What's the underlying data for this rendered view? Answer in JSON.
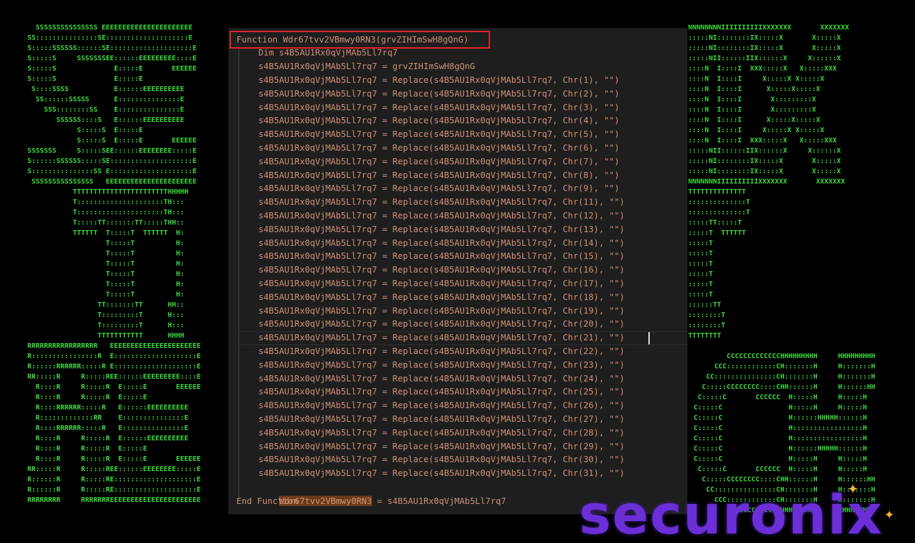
{
  "ascii_art": {
    "left": [
      "  SSSSSSSSSSSSSSS EEEEEEEEEEEEEEEEEEEEEE",
      "SS:::::::::::::::SE::::::::::::::::::::E",
      "S:::::SSSSSS::::::SE::::::::::::::::::::E",
      "S:::::S     SSSSSSSEE::::::EEEEEEEEE::::E",
      "S:::::S              E:::::E       EEEEEE",
      "S:::::S              E:::::E",
      " S::::SSSS           E::::::EEEEEEEEEE",
      "  SS::::::SSSSS      E:::::::::::::::E",
      "    SSS::::::::SS    E:::::::::::::::E",
      "       SSSSSS::::S   E::::::EEEEEEEEEE",
      "            S:::::S  E:::::E",
      "            S:::::S  E:::::E       EEEEEE",
      "SSSSSSS     S:::::SEE::::::EEEEEEEE:::::E",
      "S::::::SSSSSS:::::SE::::::::::::::::::::E",
      "S:::::::::::::::SS E::::::::::::::::::::E",
      " SSSSSSSSSSSSSSS   EEEEEEEEEEEEEEEEEEEEEE",
      "           TTTTTTTTTTTTTTTTTTTTTTTHHHHH",
      "           T:::::::::::::::::::::TH:::",
      "           T:::::::::::::::::::::TH:::",
      "           T:::::TT:::::::TT:::::THH::",
      "           TTTTTT  T:::::T  TTTTTT  H:",
      "                   T:::::T          H:",
      "                   T:::::T          H:",
      "                   T:::::T          H:",
      "                   T:::::T          H:",
      "                   T:::::T          H:",
      "                   T:::::T          H:",
      "                 TT:::::::TT      HH::",
      "                 T:::::::::T      H:::",
      "                 T:::::::::T      H:::",
      "                 TTTTTTTTTTT      HHHH",
      "RRRRRRRRRRRRRRRRR   EEEEEEEEEEEEEEEEEEEEEE",
      "R::::::::::::::::R  E::::::::::::::::::::E",
      "R::::::RRRRRR:::::R E::::::::::::::::::::E",
      "RR:::::R     R:::::REE::::::EEEEEEEEE::::E",
      "  R::::R     R:::::R  E:::::E       EEEEEE",
      "  R::::R     R:::::R  E:::::E",
      "  R::::RRRRRR:::::R   E::::::EEEEEEEEEE",
      "  R:::::::::::::RR    E:::::::::::::::E",
      "  R::::RRRRRR:::::R   E:::::::::::::::E",
      "  R::::R     R:::::R  E::::::EEEEEEEEEE",
      "  R::::R     R:::::R  E:::::E",
      "  R::::R     R:::::R  E:::::E       EEEEEE",
      "RR:::::R     R:::::REE::::::EEEEEEEE:::::E",
      "R::::::R     R:::::RE::::::::::::::::::::E",
      "R::::::R     R:::::RE::::::::::::::::::::E",
      "RRRRRRRR     RRRRRRREEEEEEEEEEEEEEEEEEEEEE"
    ],
    "right": [
      "NNNNNNNNIIIIIIIIIIXXXXXXX       XXXXXXX",
      ":::::NI::::::::IX:::::X       X:::::X",
      ":::::NI::::::::IX:::::X       X:::::X",
      ":::::NII::::::IIX::::::X     X::::::X",
      "::::N  I::::I  XXX:::::X   X:::::XXX",
      "::::N  I::::I     X:::::X X:::::X",
      "::::N  I::::I      X:::::X:::::X",
      "::::N  I::::I       X:::::::::X",
      "::::N  I::::I       X:::::::::X",
      "::::N  I::::I      X:::::X:::::X",
      "::::N  I::::I     X:::::X X:::::X",
      "::::N  I::::I  XXX:::::X   X:::::XXX",
      ":::::NII::::::IIX::::::X     X::::::X",
      ":::::NI::::::::IX:::::X       X:::::X",
      ":::::NI::::::::IX:::::X       X:::::X",
      "NNNNNNNIIIIIIIIIIXXXXXXX       XXXXXXX",
      "TTTTTTTTTTTTTT",
      "::::::::::::::T",
      "::::::::::::::T",
      ":::::TT:::::T",
      ":::::T  TTTTTT",
      ":::::T",
      ":::::T",
      ":::::T",
      ":::::T",
      ":::::T",
      ":::::T",
      "::::::TT",
      "::::::::T",
      "::::::::T",
      "TTTTTTTT"
    ],
    "bottom_right": [
      "         CCCCCCCCCCCCCHHHHHHHHH     HHHHHHHHH",
      "      CCC::::::::::::CH:::::::H     H:::::::H",
      "    CC:::::::::::::::CH:::::::H     H:::::::H",
      "   C:::::CCCCCCCC::::CHH::::::H     H::::::HH",
      "  C:::::C       CCCCCC  H:::::H     H:::::H",
      " C:::::C                H:::::H     H:::::H",
      " C:::::C                H::::::HHHHH::::::H",
      " C:::::C                H:::::::::::::::::H",
      " C:::::C                H:::::::::::::::::H",
      " C:::::C                H::::::HHHHH::::::H",
      " C:::::C                H:::::H     H:::::H",
      "  C:::::C       CCCCCC  H:::::H     H:::::H",
      "   C:::::CCCCCCCC::::CHH::::::H     H::::::HH",
      "    CC:::::::::::::::CH:::::::H     H:::::::H",
      "      CCC::::::::::::CH:::::::H     H:::::::H",
      "         CCCCCCCCCCCCCHHHHHHHHH     HHHHHHHHH"
    ]
  },
  "editor": {
    "header": "Function Wdr67tvv2VBmwy0RN3(grvZIHImSwH8gQnG)",
    "dim_line": "Dim s4B5AU1Rx0qVjMAb5Ll7rq7",
    "assign_line": "s4B5AU1Rx0qVjMAb5Ll7rq7 = grvZIHImSwH8gQnG",
    "replace_lines": [
      "s4B5AU1Rx0qVjMAb5Ll7rq7 = Replace(s4B5AU1Rx0qVjMAb5Ll7rq7, Chr(1), \"\")",
      "s4B5AU1Rx0qVjMAb5Ll7rq7 = Replace(s4B5AU1Rx0qVjMAb5Ll7rq7, Chr(2), \"\")",
      "s4B5AU1Rx0qVjMAb5Ll7rq7 = Replace(s4B5AU1Rx0qVjMAb5Ll7rq7, Chr(3), \"\")",
      "s4B5AU1Rx0qVjMAb5Ll7rq7 = Replace(s4B5AU1Rx0qVjMAb5Ll7rq7, Chr(4), \"\")",
      "s4B5AU1Rx0qVjMAb5Ll7rq7 = Replace(s4B5AU1Rx0qVjMAb5Ll7rq7, Chr(5), \"\")",
      "s4B5AU1Rx0qVjMAb5Ll7rq7 = Replace(s4B5AU1Rx0qVjMAb5Ll7rq7, Chr(6), \"\")",
      "s4B5AU1Rx0qVjMAb5Ll7rq7 = Replace(s4B5AU1Rx0qVjMAb5Ll7rq7, Chr(7), \"\")",
      "s4B5AU1Rx0qVjMAb5Ll7rq7 = Replace(s4B5AU1Rx0qVjMAb5Ll7rq7, Chr(8), \"\")",
      "s4B5AU1Rx0qVjMAb5Ll7rq7 = Replace(s4B5AU1Rx0qVjMAb5Ll7rq7, Chr(9), \"\")",
      "s4B5AU1Rx0qVjMAb5Ll7rq7 = Replace(s4B5AU1Rx0qVjMAb5Ll7rq7, Chr(11), \"\")",
      "s4B5AU1Rx0qVjMAb5Ll7rq7 = Replace(s4B5AU1Rx0qVjMAb5Ll7rq7, Chr(12), \"\")",
      "s4B5AU1Rx0qVjMAb5Ll7rq7 = Replace(s4B5AU1Rx0qVjMAb5Ll7rq7, Chr(13), \"\")",
      "s4B5AU1Rx0qVjMAb5Ll7rq7 = Replace(s4B5AU1Rx0qVjMAb5Ll7rq7, Chr(14), \"\")",
      "s4B5AU1Rx0qVjMAb5Ll7rq7 = Replace(s4B5AU1Rx0qVjMAb5Ll7rq7, Chr(15), \"\")",
      "s4B5AU1Rx0qVjMAb5Ll7rq7 = Replace(s4B5AU1Rx0qVjMAb5Ll7rq7, Chr(16), \"\")",
      "s4B5AU1Rx0qVjMAb5Ll7rq7 = Replace(s4B5AU1Rx0qVjMAb5Ll7rq7, Chr(17), \"\")",
      "s4B5AU1Rx0qVjMAb5Ll7rq7 = Replace(s4B5AU1Rx0qVjMAb5Ll7rq7, Chr(18), \"\")",
      "s4B5AU1Rx0qVjMAb5Ll7rq7 = Replace(s4B5AU1Rx0qVjMAb5Ll7rq7, Chr(19), \"\")",
      "s4B5AU1Rx0qVjMAb5Ll7rq7 = Replace(s4B5AU1Rx0qVjMAb5Ll7rq7, Chr(20), \"\")",
      "s4B5AU1Rx0qVjMAb5Ll7rq7 = Replace(s4B5AU1Rx0qVjMAb5Ll7rq7, Chr(21), \"\")",
      "s4B5AU1Rx0qVjMAb5Ll7rq7 = Replace(s4B5AU1Rx0qVjMAb5Ll7rq7, Chr(22), \"\")",
      "s4B5AU1Rx0qVjMAb5Ll7rq7 = Replace(s4B5AU1Rx0qVjMAb5Ll7rq7, Chr(23), \"\")",
      "s4B5AU1Rx0qVjMAb5Ll7rq7 = Replace(s4B5AU1Rx0qVjMAb5Ll7rq7, Chr(24), \"\")",
      "s4B5AU1Rx0qVjMAb5Ll7rq7 = Replace(s4B5AU1Rx0qVjMAb5Ll7rq7, Chr(25), \"\")",
      "s4B5AU1Rx0qVjMAb5Ll7rq7 = Replace(s4B5AU1Rx0qVjMAb5Ll7rq7, Chr(26), \"\")",
      "s4B5AU1Rx0qVjMAb5Ll7rq7 = Replace(s4B5AU1Rx0qVjMAb5Ll7rq7, Chr(27), \"\")",
      "s4B5AU1Rx0qVjMAb5Ll7rq7 = Replace(s4B5AU1Rx0qVjMAb5Ll7rq7, Chr(28), \"\")",
      "s4B5AU1Rx0qVjMAb5Ll7rq7 = Replace(s4B5AU1Rx0qVjMAb5Ll7rq7, Chr(29), \"\")",
      "s4B5AU1Rx0qVjMAb5Ll7rq7 = Replace(s4B5AU1Rx0qVjMAb5Ll7rq7, Chr(30), \"\")",
      "s4B5AU1Rx0qVjMAb5Ll7rq7 = Replace(s4B5AU1Rx0qVjMAb5Ll7rq7, Chr(31), \"\")"
    ],
    "return_name": "Wdr67tvv2VBmwy0RN3",
    "return_rest": " = s4B5AU1Rx0qVjMAb5Ll7rq7",
    "end_line": "End Function"
  },
  "logo": {
    "text": "securonix"
  },
  "colors": {
    "ascii_green": "#3fd83f",
    "editor_bg": "#1e1e1e",
    "code_text": "#ce9178",
    "highlight_box": "#e0262d",
    "logo_purple": "#6a2fd6",
    "logo_sparkle": "#f3b33c"
  }
}
